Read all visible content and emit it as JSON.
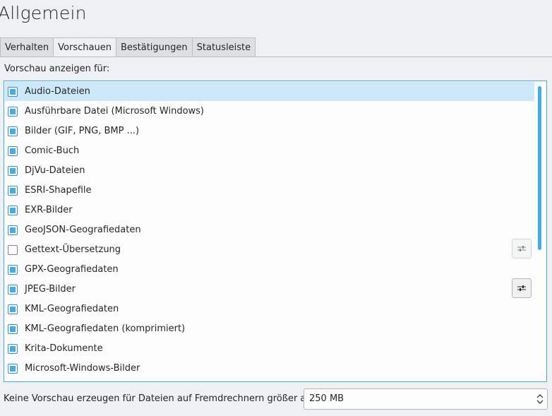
{
  "page": {
    "title": "Allgemein"
  },
  "tabs": [
    {
      "label": "Verhalten",
      "active": false
    },
    {
      "label": "Vorschauen",
      "active": true
    },
    {
      "label": "Bestätigungen",
      "active": false
    },
    {
      "label": "Statusleiste",
      "active": false
    }
  ],
  "preview": {
    "label": "Vorschau anzeigen für:",
    "items": [
      {
        "label": "Audio-Dateien",
        "checked": true,
        "selected": true
      },
      {
        "label": "Ausführbare Datei (Microsoft Windows)",
        "checked": true
      },
      {
        "label": "Bilder (GIF, PNG, BMP ...)",
        "checked": true
      },
      {
        "label": "Comic-Buch",
        "checked": true
      },
      {
        "label": "DjVu-Dateien",
        "checked": true
      },
      {
        "label": "ESRI-Shapefile",
        "checked": true
      },
      {
        "label": "EXR-Bilder",
        "checked": true
      },
      {
        "label": "GeoJSON-Geografiedaten",
        "checked": true
      },
      {
        "label": "Gettext-Übersetzung",
        "checked": false,
        "config": "disabled"
      },
      {
        "label": "GPX-Geografiedaten",
        "checked": true
      },
      {
        "label": "JPEG-Bilder",
        "checked": true,
        "config": "enabled"
      },
      {
        "label": "KML-Geografiedaten",
        "checked": true
      },
      {
        "label": "KML-Geografiedaten (komprimiert)",
        "checked": true
      },
      {
        "label": "Krita-Dokumente",
        "checked": true
      },
      {
        "label": "Microsoft-Windows-Bilder",
        "checked": true
      }
    ]
  },
  "remote": {
    "label": "Keine Vorschau erzeugen für Dateien auf Fremdrechnern größer als:",
    "value": "250 MB"
  },
  "colors": {
    "accent": "#3daee9",
    "selection": "#cde8f8"
  },
  "icons": {
    "configure": "configure-icon",
    "spin": "spin-arrows-icon"
  }
}
